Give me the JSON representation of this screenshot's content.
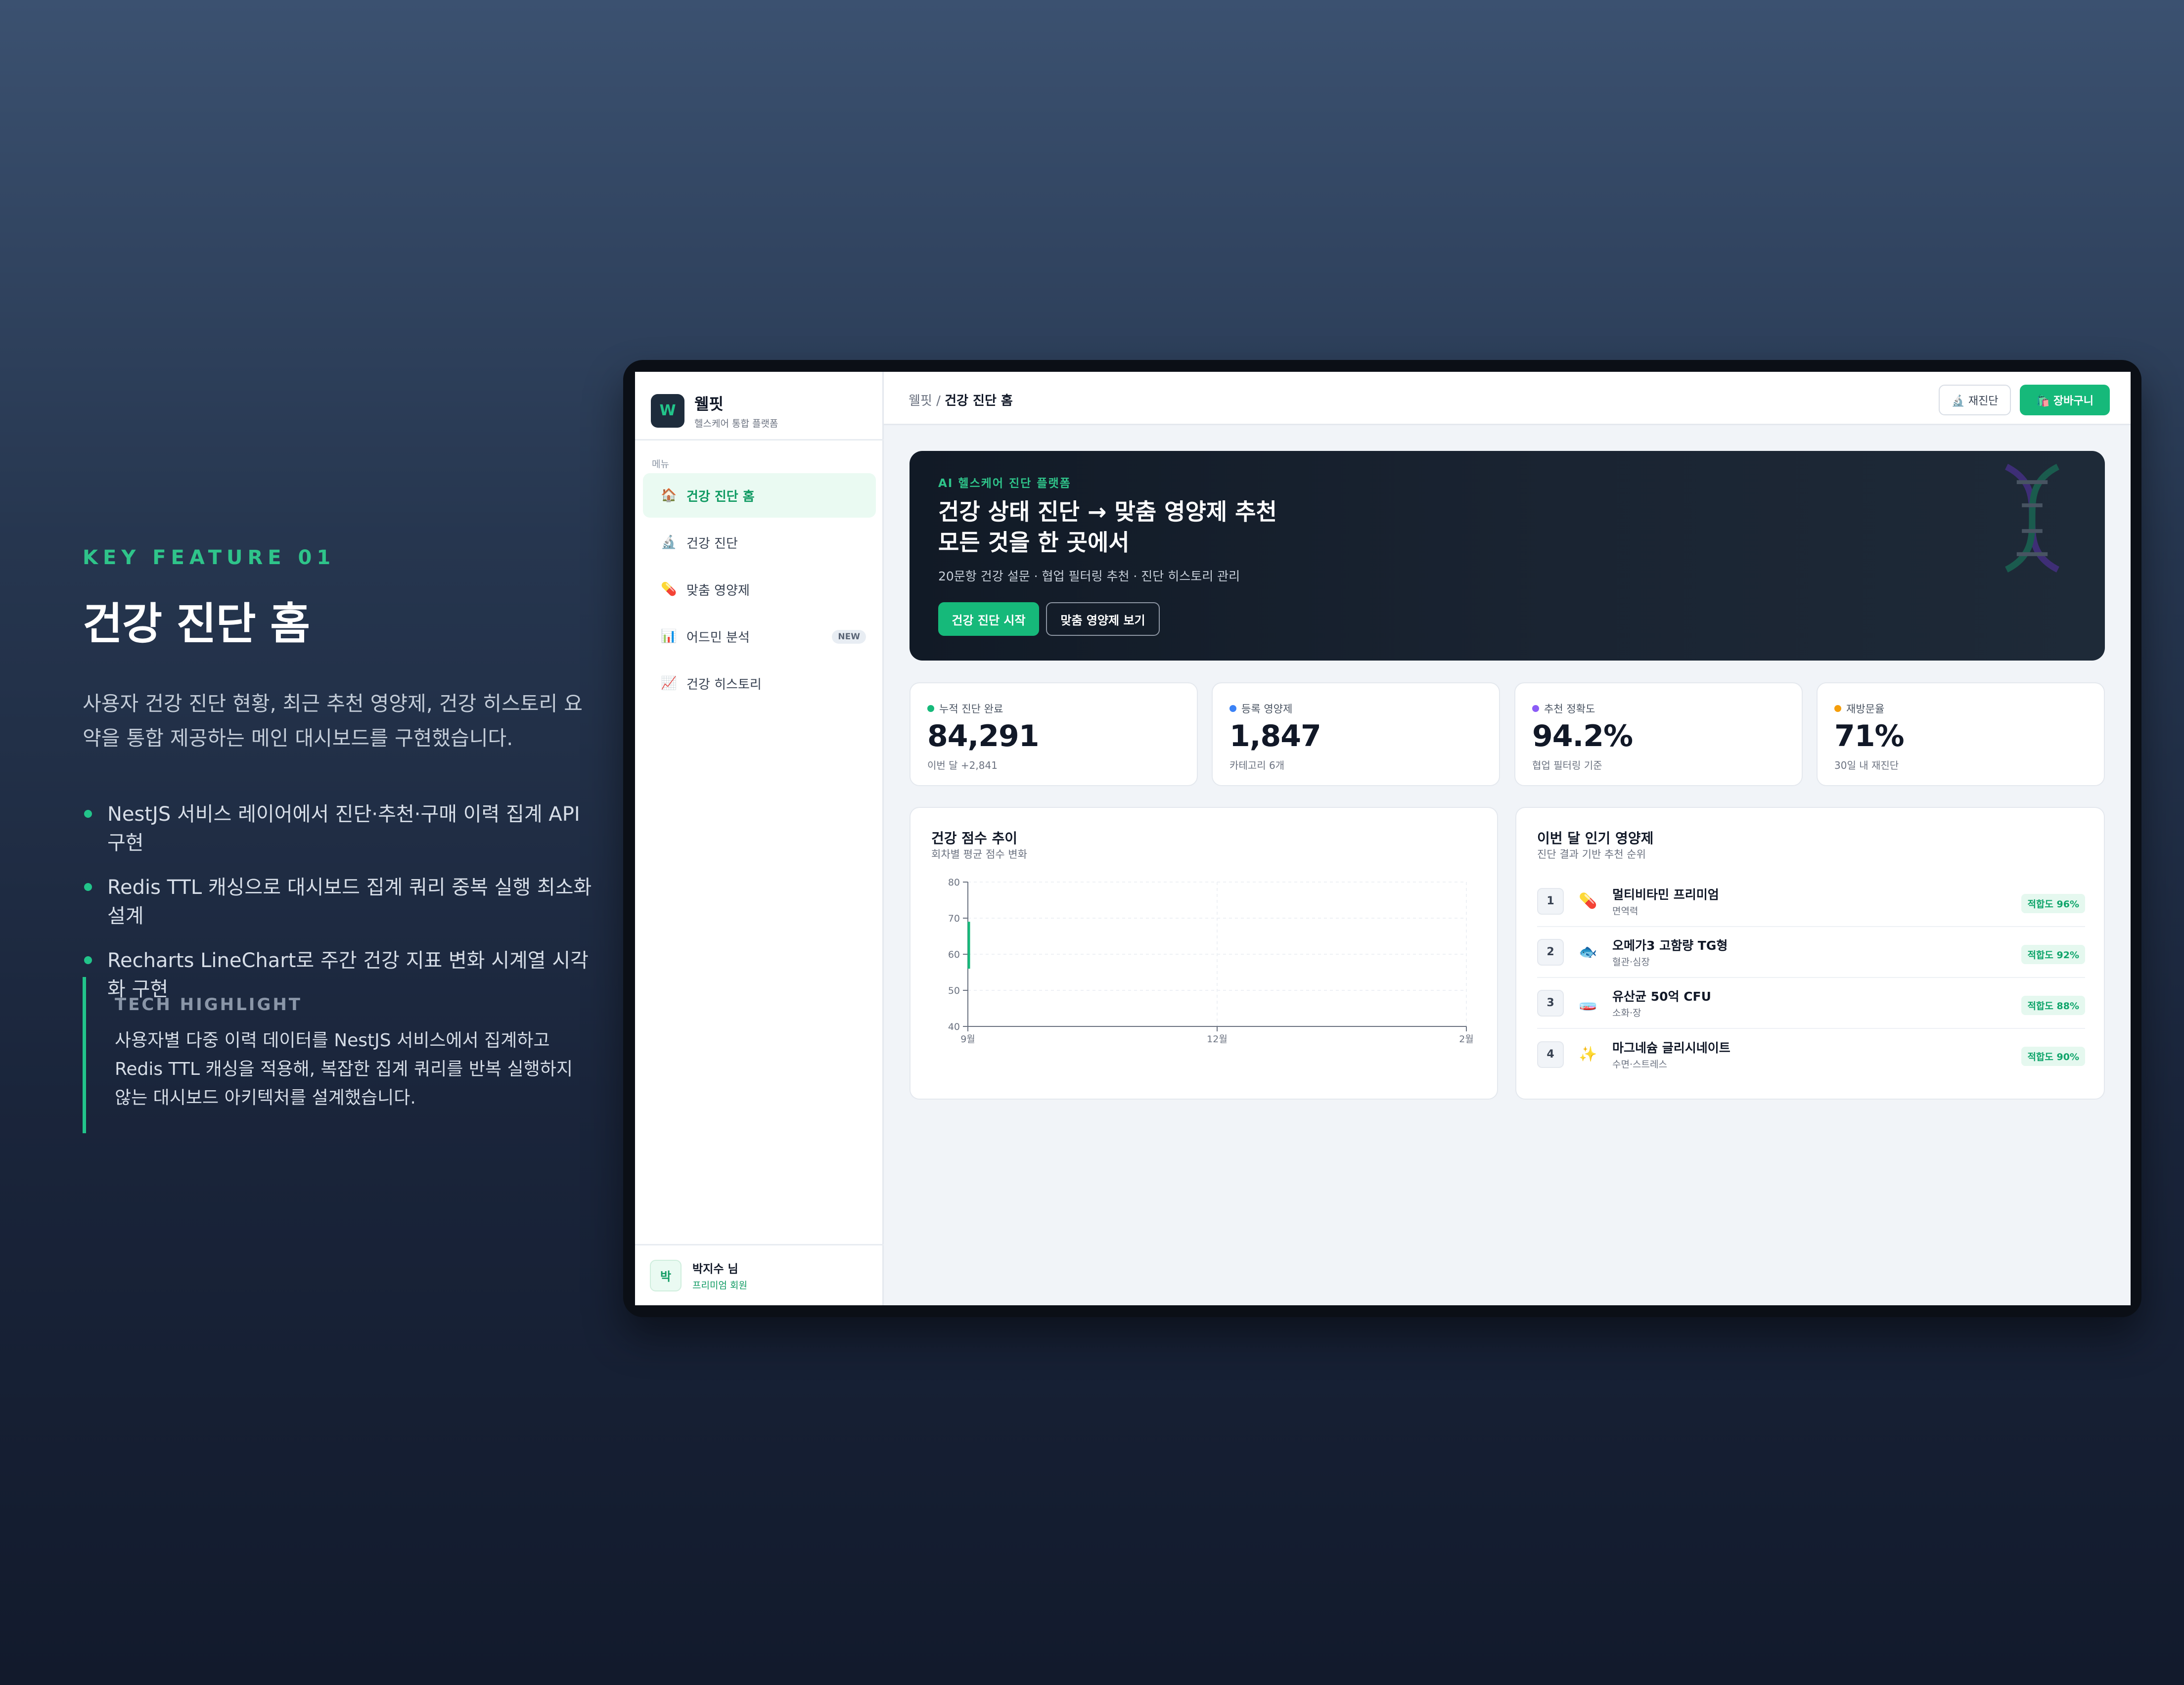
{
  "feature": {
    "eyebrow": "KEY FEATURE 01",
    "title": "건강 진단 홈",
    "description": "사용자 건강 진단 현황, 최근 추천 영양제, 건강 히스토리 요약을 통합 제공하는 메인 대시보드를 구현했습니다.",
    "bullets": [
      "NestJS 서비스 레이어에서 진단·추천·구매 이력 집계 API 구현",
      "Redis TTL 캐싱으로 대시보드 집계 쿼리 중복 실행 최소화 설계",
      "Recharts LineChart로 주간 건강 지표 변화 시계열 시각화 구현"
    ],
    "tech_label": "TECH HIGHLIGHT",
    "tech_text": "사용자별 다중 이력 데이터를 NestJS 서비스에서 집계하고 Redis TTL 캐싱을 적용해, 복잡한 집계 쿼리를 반복 실행하지 않는 대시보드 아키텍처를 설계했습니다."
  },
  "app": {
    "brand": {
      "logo": "W",
      "name": "웰핏",
      "tagline": "헬스케어 통합 플랫폼"
    },
    "menu_label": "메뉴",
    "nav": [
      {
        "icon": "🏠",
        "label": "건강 진단 홈",
        "active": true
      },
      {
        "icon": "🔬",
        "label": "건강 진단"
      },
      {
        "icon": "💊",
        "label": "맞춤 영양제"
      },
      {
        "icon": "📊",
        "label": "어드민 분석",
        "badge": "NEW"
      },
      {
        "icon": "📈",
        "label": "건강 히스토리"
      }
    ],
    "user": {
      "avatar": "박",
      "name": "박지수 님",
      "role": "프리미엄 회원"
    },
    "breadcrumb": {
      "root": "웰핏",
      "sep": " / ",
      "current": "건강 진단 홈"
    },
    "top_actions": {
      "rediagnose": "🔬 재진단",
      "cart": "🛍️ 장바구니"
    },
    "hero": {
      "kicker": "AI 헬스케어 진단 플랫폼",
      "title_line1": "건강 상태 진단 → 맞춤 영양제 추천",
      "title_line2": "모든 것을 한 곳에서",
      "subtitle": "20문항 건강 설문 · 협업 필터링 추천 · 진단 히스토리 관리",
      "primary_btn": "건강 진단 시작",
      "secondary_btn": "맞춤 영양제 보기"
    },
    "stats": [
      {
        "label": "누적 진단 완료",
        "value": "84,291",
        "note": "이번 달 +2,841",
        "color": "#16b97a"
      },
      {
        "label": "등록 영양제",
        "value": "1,847",
        "note": "카테고리 6개",
        "color": "#3b82f6"
      },
      {
        "label": "추천 정확도",
        "value": "94.2%",
        "note": "협업 필터링 기준",
        "color": "#8b5cf6"
      },
      {
        "label": "재방문율",
        "value": "71%",
        "note": "30일 내 재진단",
        "color": "#f59e0b"
      }
    ],
    "trend_card": {
      "title": "건강 점수 추이",
      "subtitle": "회차별 평균 점수 변화"
    },
    "popular_card": {
      "title": "이번 달 인기 영양제",
      "subtitle": "진단 결과 기반 추천 순위",
      "items": [
        {
          "rank": "1",
          "icon": "💊",
          "name": "멀티비타민 프리미엄",
          "category": "면역력",
          "fit": "적합도 96%"
        },
        {
          "rank": "2",
          "icon": "🐟",
          "name": "오메가3 고함량 TG형",
          "category": "혈관·심장",
          "fit": "적합도 92%"
        },
        {
          "rank": "3",
          "icon": "🧫",
          "name": "유산균 50억 CFU",
          "category": "소화·장",
          "fit": "적합도 88%"
        },
        {
          "rank": "4",
          "icon": "✨",
          "name": "마그네슘 글리시네이트",
          "category": "수면·스트레스",
          "fit": "적합도 90%"
        }
      ]
    }
  },
  "chart_data": {
    "type": "line",
    "title": "건강 점수 추이",
    "subtitle": "회차별 평균 점수 변화",
    "x": [
      "9월",
      "12월",
      "2월"
    ],
    "yticks": [
      40,
      50,
      60,
      70,
      80
    ],
    "ylim": [
      40,
      80
    ],
    "grid": true,
    "series": [
      {
        "values": [
          null,
          null,
          null
        ],
        "color": "#16b97a"
      }
    ],
    "note": "line rendered only as short segment near start (values 56–69 at first x)",
    "visible_segment": {
      "x": "9월",
      "y_from": 56,
      "y_to": 69
    }
  }
}
